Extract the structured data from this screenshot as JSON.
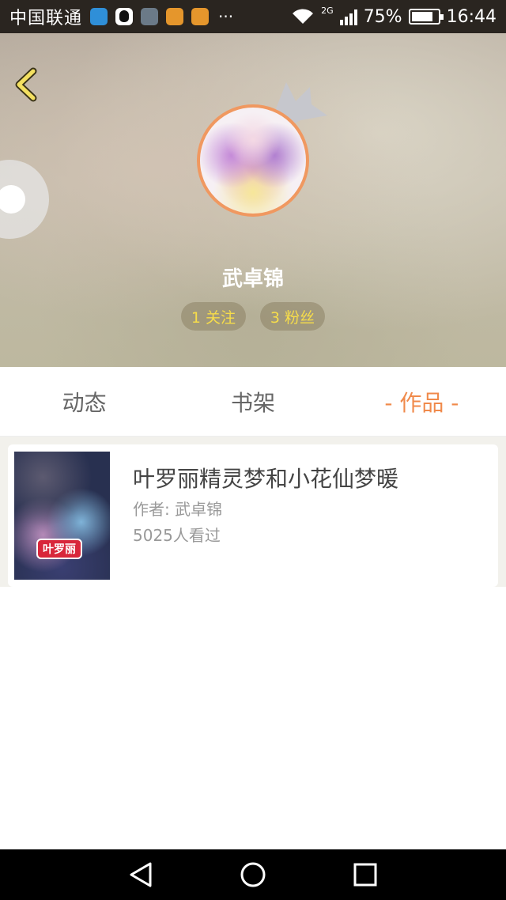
{
  "status_bar": {
    "carrier": "中国联通",
    "app_icons": [
      "blue-app-icon",
      "qq-icon",
      "gallery-icon",
      "orange-app-icon",
      "orange-app-icon"
    ],
    "more": "···",
    "network": "2G",
    "battery": "75%",
    "battery_level": 0.75,
    "time": "16:44"
  },
  "profile": {
    "username": "武卓锦",
    "following": "1 关注",
    "fans": "3 粉丝"
  },
  "tabs": [
    {
      "label": "动态",
      "active": false
    },
    {
      "label": "书架",
      "active": false
    },
    {
      "label": "- 作品 -",
      "active": true
    }
  ],
  "works": [
    {
      "title": "叶罗丽精灵梦和小花仙梦暖",
      "author": "作者: 武卓锦",
      "views": "5025人看过",
      "cover_text": "叶罗丽"
    }
  ],
  "colors": {
    "accent": "#f08a4b",
    "pill_text": "#f7dd4a",
    "avatar_border": "#f09860"
  }
}
